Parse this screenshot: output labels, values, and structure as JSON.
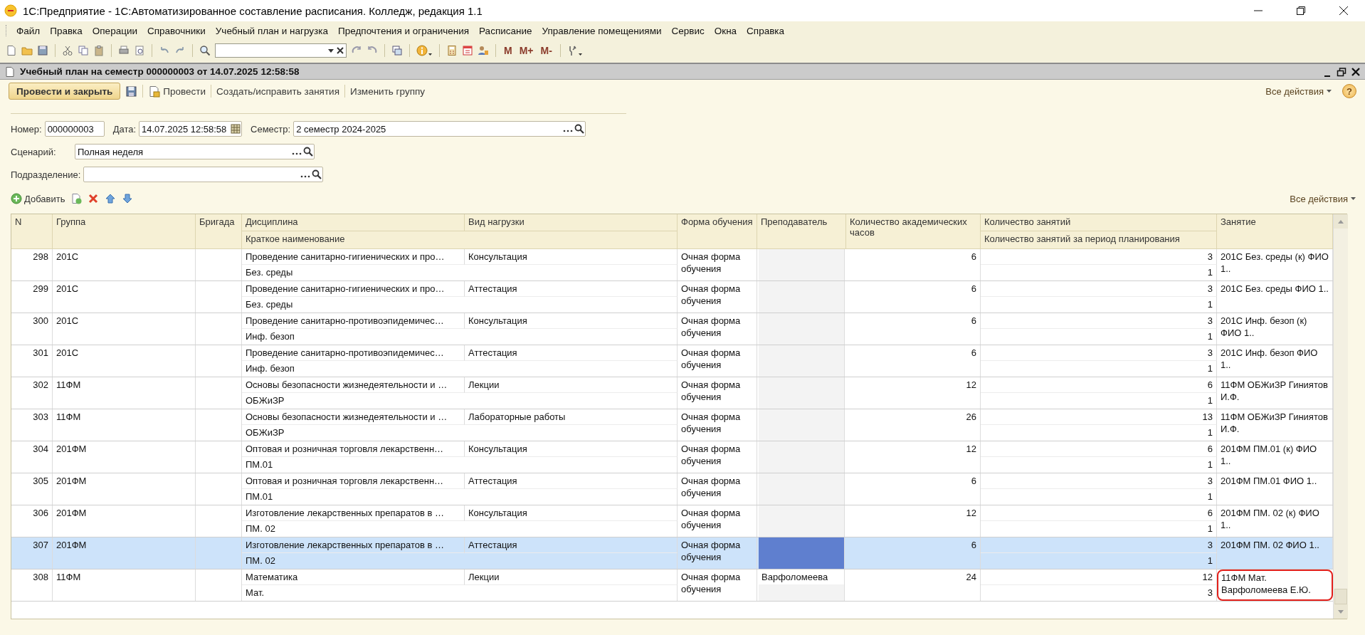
{
  "window": {
    "title": "1С:Предприятие - 1С:Автоматизированное составление расписания. Колледж, редакция 1.1"
  },
  "menu": [
    "Файл",
    "Правка",
    "Операции",
    "Справочники",
    "Учебный план и нагрузка",
    "Предпочтения и ограничения",
    "Расписание",
    "Управление помещениями",
    "Сервис",
    "Окна",
    "Справка"
  ],
  "toolbar": {
    "memory_buttons": [
      "M",
      "M+",
      "M-"
    ]
  },
  "form": {
    "title": "Учебный план на семестр 000000003 от 14.07.2025 12:58:58",
    "commands": {
      "primary": "Провести и закрыть",
      "post": "Провести",
      "links": [
        "Создать/исправить занятия",
        "Изменить группу"
      ],
      "all_actions": "Все действия",
      "help": "?"
    },
    "field_rows": [
      [
        {
          "label": "Номер:",
          "value": "000000003",
          "kind": "text"
        },
        {
          "label": "Дата:",
          "value": "14.07.2025 12:58:58",
          "kind": "date"
        },
        {
          "label": "Семестр:",
          "value": "2 семестр 2024-2025",
          "kind": "choice"
        }
      ],
      [
        {
          "label": "Сценарий:",
          "value": "Полная неделя",
          "kind": "choice"
        }
      ],
      [
        {
          "label": "Подразделение:",
          "kind": "choice"
        }
      ]
    ],
    "table_toolbar": {
      "add": "Добавить",
      "all_actions": "Все действия"
    },
    "table": {
      "columns": [
        "N",
        "Группа",
        "Бригада",
        "Дисциплина",
        "Вид нагрузки",
        "Форма обучения",
        "Преподаватель",
        "Количество академических часов",
        "Количество занятий",
        "Занятие"
      ],
      "sub_columns": [
        "Краткое наименование",
        "Количество занятий за период планирования"
      ],
      "rows": [
        {
          "n": "298",
          "group": "201С",
          "discipline": "Проведение санитарно-гигиенических и про…",
          "short_name": "Без. среды",
          "load_type": "Консультация",
          "form": "Очная форма обучения",
          "hours": "6",
          "lessons": "3",
          "lessons_period": "1",
          "lesson": "201С Без. среды (к) ФИО 1..",
          "selected": false,
          "annotated": false
        },
        {
          "n": "299",
          "group": "201С",
          "discipline": "Проведение санитарно-гигиенических и про…",
          "short_name": "Без. среды",
          "load_type": "Аттестация",
          "form": "Очная форма обучения",
          "hours": "6",
          "lessons": "3",
          "lessons_period": "1",
          "lesson": "201С Без. среды ФИО 1..",
          "selected": false,
          "annotated": false
        },
        {
          "n": "300",
          "group": "201С",
          "discipline": "Проведение санитарно-противоэпидемичес…",
          "short_name": "Инф. безоп",
          "load_type": "Консультация",
          "form": "Очная форма обучения",
          "hours": "6",
          "lessons": "3",
          "lessons_period": "1",
          "lesson": "201С Инф. безоп (к) ФИО 1..",
          "selected": false,
          "annotated": false
        },
        {
          "n": "301",
          "group": "201С",
          "discipline": "Проведение санитарно-противоэпидемичес…",
          "short_name": "Инф. безоп",
          "load_type": "Аттестация",
          "form": "Очная форма обучения",
          "hours": "6",
          "lessons": "3",
          "lessons_period": "1",
          "lesson": "201С Инф. безоп ФИО 1..",
          "selected": false,
          "annotated": false
        },
        {
          "n": "302",
          "group": "11ФМ",
          "discipline": "Основы безопасности жизнедеятельности и …",
          "short_name": "ОБЖиЗР",
          "load_type": "Лекции",
          "form": "Очная форма обучения",
          "hours": "12",
          "lessons": "6",
          "lessons_period": "1",
          "lesson": "11ФМ ОБЖиЗР Гиниятов И.Ф.",
          "selected": false,
          "annotated": false
        },
        {
          "n": "303",
          "group": "11ФМ",
          "discipline": "Основы безопасности жизнедеятельности и …",
          "short_name": "ОБЖиЗР",
          "load_type": "Лабораторные работы",
          "form": "Очная форма обучения",
          "hours": "26",
          "lessons": "13",
          "lessons_period": "1",
          "lesson": "11ФМ ОБЖиЗР Гиниятов И.Ф.",
          "selected": false,
          "annotated": false
        },
        {
          "n": "304",
          "group": "201ФМ",
          "discipline": "Оптовая и розничная торговля лекарственн…",
          "short_name": "ПМ.01",
          "load_type": "Консультация",
          "form": "Очная форма обучения",
          "hours": "12",
          "lessons": "6",
          "lessons_period": "1",
          "lesson": "201ФМ ПМ.01 (к) ФИО 1..",
          "selected": false,
          "annotated": false
        },
        {
          "n": "305",
          "group": "201ФМ",
          "discipline": "Оптовая и розничная торговля лекарственн…",
          "short_name": "ПМ.01",
          "load_type": "Аттестация",
          "form": "Очная форма обучения",
          "hours": "6",
          "lessons": "3",
          "lessons_period": "1",
          "lesson": "201ФМ ПМ.01 ФИО 1..",
          "selected": false,
          "annotated": false
        },
        {
          "n": "306",
          "group": "201ФМ",
          "discipline": "Изготовление лекарственных препаратов в …",
          "short_name": "ПМ. 02",
          "load_type": "Консультация",
          "form": "Очная форма обучения",
          "hours": "12",
          "lessons": "6",
          "lessons_period": "1",
          "lesson": "201ФМ ПМ. 02 (к) ФИО 1..",
          "selected": false,
          "annotated": false
        },
        {
          "n": "307",
          "group": "201ФМ",
          "discipline": "Изготовление лекарственных препаратов в …",
          "short_name": "ПМ. 02",
          "load_type": "Аттестация",
          "form": "Очная форма обучения",
          "hours": "6",
          "lessons": "3",
          "lessons_period": "1",
          "lesson": "201ФМ ПМ. 02 ФИО 1..",
          "selected": true,
          "annotated": false
        },
        {
          "n": "308",
          "group": "11ФМ",
          "discipline": "Математика",
          "short_name": "Мат.",
          "load_type": "Лекции",
          "form": "Очная форма обучения",
          "teacher": "Варфоломеева",
          "hours": "24",
          "lessons": "12",
          "lessons_period": "3",
          "lesson": "11ФМ Мат. Варфоломеева Е.Ю.",
          "selected": false,
          "annotated": true
        }
      ]
    }
  }
}
